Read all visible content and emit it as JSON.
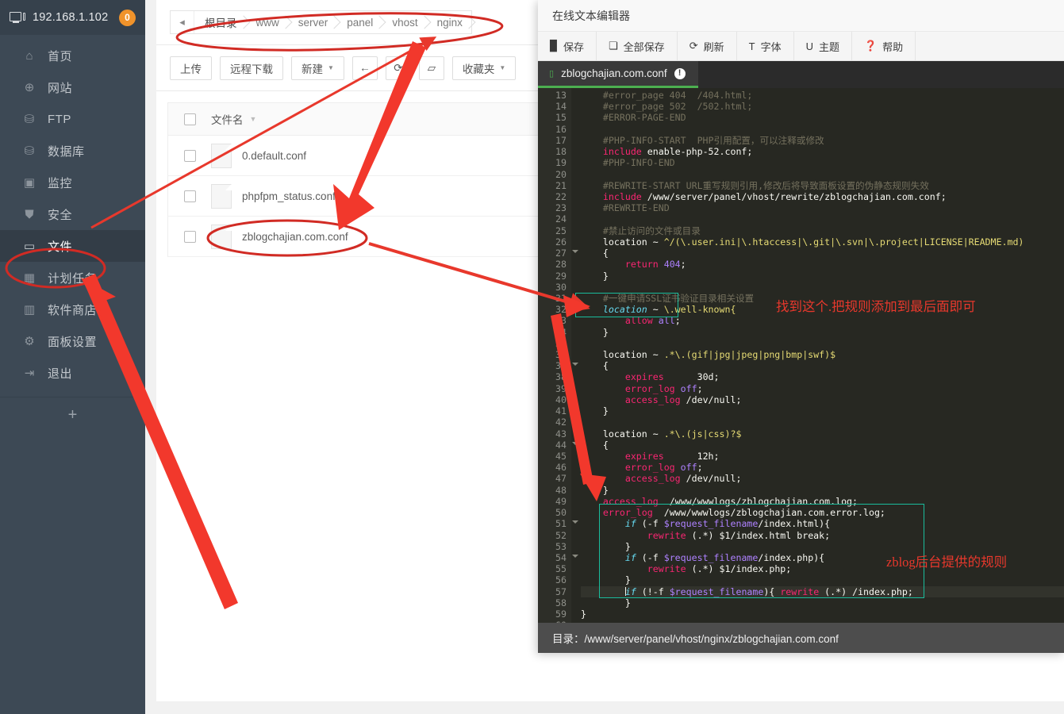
{
  "sidebar": {
    "ip": "192.168.1.102",
    "badge": "0",
    "add_label": "+",
    "items": [
      {
        "label": "首页",
        "icon": "home-icon",
        "glyph": "⌂"
      },
      {
        "label": "网站",
        "icon": "globe-icon",
        "glyph": "⊕"
      },
      {
        "label": "FTP",
        "icon": "ftp-icon",
        "glyph": "⛁"
      },
      {
        "label": "数据库",
        "icon": "database-icon",
        "glyph": "⛁"
      },
      {
        "label": "监控",
        "icon": "monitor-icon",
        "glyph": "▣"
      },
      {
        "label": "安全",
        "icon": "shield-icon",
        "glyph": "⛊"
      },
      {
        "label": "文件",
        "icon": "folder-icon",
        "glyph": "▭"
      },
      {
        "label": "计划任务",
        "icon": "calendar-icon",
        "glyph": "▦"
      },
      {
        "label": "软件商店",
        "icon": "apps-icon",
        "glyph": "▥"
      },
      {
        "label": "面板设置",
        "icon": "gear-icon",
        "glyph": "⚙"
      },
      {
        "label": "退出",
        "icon": "logout-icon",
        "glyph": "⇥"
      }
    ],
    "active_index": 6
  },
  "filemanager": {
    "breadcrumb_back": "◂",
    "breadcrumbs": [
      "根目录",
      "www",
      "server",
      "panel",
      "vhost",
      "nginx"
    ],
    "toolbar": {
      "upload": "上传",
      "remote_download": "远程下载",
      "new": "新建",
      "back_icon": "←",
      "refresh_icon": "⟳",
      "terminal_icon": "▱",
      "favorites": "收藏夹",
      "root_label": "根目录",
      "caret": "▾"
    },
    "table": {
      "header_name": "文件名",
      "sort_caret": "▾",
      "rows": [
        {
          "name": "0.default.conf"
        },
        {
          "name": "phpfpm_status.conf"
        },
        {
          "name": "zblogchajian.com.conf"
        }
      ]
    }
  },
  "editor": {
    "window_title": "在线文本编辑器",
    "tools": [
      {
        "label": "保存",
        "icon": "save-icon",
        "glyph": "💾"
      },
      {
        "label": "全部保存",
        "icon": "save-all-icon",
        "glyph": "🗐"
      },
      {
        "label": "刷新",
        "icon": "refresh-icon",
        "glyph": "⟳"
      },
      {
        "label": "字体",
        "icon": "font-icon",
        "glyph": "T"
      },
      {
        "label": "主题",
        "icon": "theme-icon",
        "glyph": "U"
      },
      {
        "label": "帮助",
        "icon": "help-icon",
        "glyph": "?"
      }
    ],
    "tab": {
      "name": "zblogchajian.com.conf",
      "info_icon": "!"
    },
    "status": "目录：/www/server/panel/vhost/nginx/zblogchajian.com.conf",
    "first_line_number": 13,
    "lines": [
      {
        "n": 13,
        "html": "    <span class='cm'>#error_page 404  /404.html;</span>"
      },
      {
        "n": 14,
        "html": "    <span class='cm'>#error_page 502  /502.html;</span>"
      },
      {
        "n": 15,
        "html": "    <span class='cm'>#ERROR-PAGE-END</span>"
      },
      {
        "n": 16,
        "html": ""
      },
      {
        "n": 17,
        "html": "    <span class='cm'>#PHP-INFO-START  PHP引用配置，可以注释或修改</span>"
      },
      {
        "n": 18,
        "html": "    <span class='kw'>include</span> enable-php-52.conf;"
      },
      {
        "n": 19,
        "html": "    <span class='cm'>#PHP-INFO-END</span>"
      },
      {
        "n": 20,
        "html": ""
      },
      {
        "n": 21,
        "html": "    <span class='cm'>#REWRITE-START URL重写规则引用,修改后将导致面板设置的伪静态规则失效</span>"
      },
      {
        "n": 22,
        "html": "    <span class='kw'>include</span> /www/server/panel/vhost/rewrite/zblogchajian.com.conf;"
      },
      {
        "n": 23,
        "html": "    <span class='cm'>#REWRITE-END</span>"
      },
      {
        "n": 24,
        "html": ""
      },
      {
        "n": 25,
        "html": "    <span class='cm'>#禁止访问的文件或目录</span>"
      },
      {
        "n": 26,
        "html": "    location ~ <span class='str'>^/(\\.user.ini|\\.htaccess|\\.git|\\.svn|\\.project|LICENSE|README.md)</span>"
      },
      {
        "n": 27,
        "html": "    {",
        "fold": true
      },
      {
        "n": 28,
        "html": "        <span class='kw'>return</span> <span class='num'>404</span>;"
      },
      {
        "n": 29,
        "html": "    }"
      },
      {
        "n": 30,
        "html": ""
      },
      {
        "n": 31,
        "html": "    <span class='cm'>#一键申请SSL证书验证目录相关设置</span>"
      },
      {
        "n": 32,
        "html": "    <span class='fn'>location</span> ~ <span class='str'>\\.well-known{</span>"
      },
      {
        "n": 33,
        "html": "        <span class='kw'>allow</span> <span class='num'>all</span>;"
      },
      {
        "n": 34,
        "html": "    }"
      },
      {
        "n": 35,
        "html": ""
      },
      {
        "n": 36,
        "html": "    location ~ <span class='str'>.*\\.(gif|jpg|jpeg|png|bmp|swf)$</span>"
      },
      {
        "n": 37,
        "html": "    {",
        "fold": true
      },
      {
        "n": 38,
        "html": "        <span class='kw'>expires</span>      30d;"
      },
      {
        "n": 39,
        "html": "        <span class='kw'>error_log</span> <span class='num'>off</span>;"
      },
      {
        "n": 40,
        "html": "        <span class='kw'>access_log</span> /dev/null;"
      },
      {
        "n": 41,
        "html": "    }"
      },
      {
        "n": 42,
        "html": ""
      },
      {
        "n": 43,
        "html": "    location ~ <span class='str'>.*\\.(js|css)?$</span>"
      },
      {
        "n": 44,
        "html": "    {",
        "fold": true
      },
      {
        "n": 45,
        "html": "        <span class='kw'>expires</span>      12h;"
      },
      {
        "n": 46,
        "html": "        <span class='kw'>error_log</span> <span class='num'>off</span>;"
      },
      {
        "n": 47,
        "html": "        <span class='kw'>access_log</span> /dev/null;"
      },
      {
        "n": 48,
        "html": "    }"
      },
      {
        "n": 49,
        "html": "    <span class='kw'>access_log</span>  /www/wwwlogs/zblogchajian.com.log;"
      },
      {
        "n": 50,
        "html": "    <span class='kw'>error_log</span>  /www/wwwlogs/zblogchajian.com.error.log;"
      },
      {
        "n": 51,
        "html": "        <span class='fn'>if</span> (-f <span class='num'>$request_filename</span>/index.html){",
        "fold": true
      },
      {
        "n": 52,
        "html": "            <span class='kw'>rewrite</span> (.*) $1/index.html break;"
      },
      {
        "n": 53,
        "html": "        }"
      },
      {
        "n": 54,
        "html": "        <span class='fn'>if</span> (-f <span class='num'>$request_filename</span>/index.php){",
        "fold": true
      },
      {
        "n": 55,
        "html": "            <span class='kw'>rewrite</span> (.*) $1/index.php;"
      },
      {
        "n": 56,
        "html": "        }"
      },
      {
        "n": 57,
        "html": "        <span class='cursor'></span><span class='fn'>if</span> (!-f <span class='num'>$request_filename</span>){ <span class='kw'>rewrite</span> (.*) /index.php;",
        "current": true
      },
      {
        "n": 58,
        "html": "        }"
      },
      {
        "n": 59,
        "html": "}"
      },
      {
        "n": 60,
        "html": ""
      }
    ]
  },
  "annotations": {
    "note_ssl": "找到这个.把规则添加到最后面即可",
    "note_zblog": "zblog后台提供的规则",
    "highlight_color": "#1abc9c",
    "marker_color": "#e8382c"
  }
}
